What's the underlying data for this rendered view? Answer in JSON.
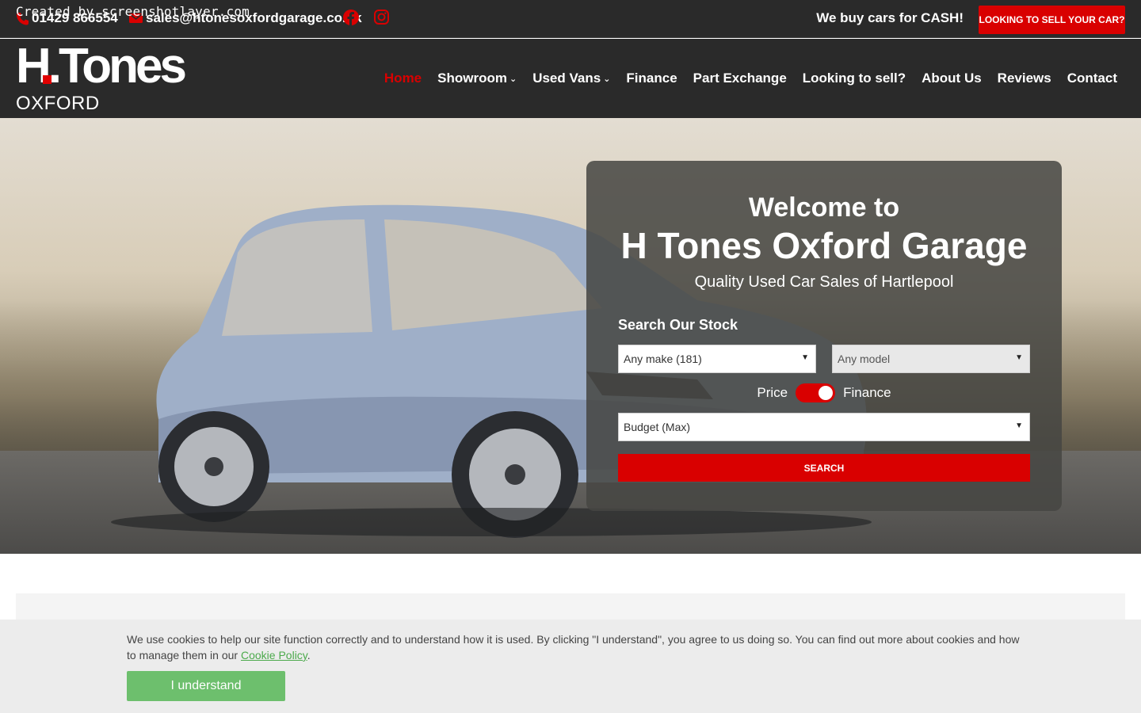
{
  "topbar": {
    "watermark": "Created by screenshotlayer.com",
    "phone": "01429 866554",
    "email": "sales@htonesoxfordgarage.co.uk",
    "cash_text": "We buy cars for CASH!",
    "sell_button": "LOOKING TO SELL YOUR CAR?",
    "social_icons": [
      "facebook-icon",
      "instagram-icon"
    ]
  },
  "header": {
    "logo_main": "H.Tones",
    "logo_sub": "OXFORD GARAGE",
    "nav": [
      {
        "label": "Home",
        "active": true
      },
      {
        "label": "Showroom",
        "dropdown": true
      },
      {
        "label": "Used Vans",
        "dropdown": true
      },
      {
        "label": "Finance"
      },
      {
        "label": "Part Exchange"
      },
      {
        "label": "Looking to sell?"
      },
      {
        "label": "About Us"
      },
      {
        "label": "Reviews"
      },
      {
        "label": "Contact"
      }
    ]
  },
  "hero": {
    "welcome_line1": "Welcome to",
    "welcome_line2": "H Tones Oxford Garage",
    "tagline": "Quality Used Car Sales of Hartlepool",
    "search_title": "Search Our Stock",
    "make_select": "Any make (181)",
    "model_select": "Any model",
    "toggle_left": "Price",
    "toggle_right": "Finance",
    "budget_select": "Budget (Max)",
    "search_button": "SEARCH"
  },
  "cookie": {
    "text": "We use cookies to help our site function correctly and to understand how it is used. By clicking \"I understand\", you agree to us doing so. You can find out more about cookies and how to manage them in our ",
    "link": "Cookie Policy",
    "period": ".",
    "button": "I understand"
  },
  "colors": {
    "accent": "#d90000",
    "dark": "#2a2a2a",
    "cookie_button": "#6dbf6d"
  }
}
